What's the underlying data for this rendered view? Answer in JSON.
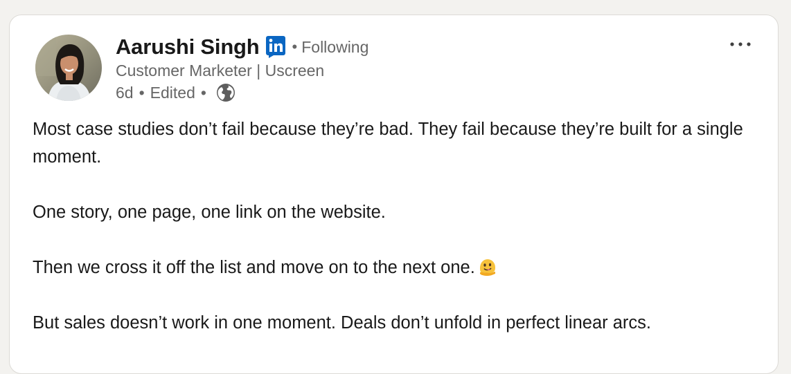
{
  "post": {
    "author": {
      "name": "Aarushi Singh",
      "follow_status": "Following",
      "separator": "•",
      "headline": "Customer Marketer | Uscreen"
    },
    "meta": {
      "age": "6d",
      "edited": "Edited",
      "separator": "•",
      "visibility_icon": "globe-icon"
    },
    "badge_icon": "linkedin-badge-icon",
    "more_icon": "more-options-icon",
    "body": {
      "paragraph_1": "Most case studies don’t fail because they’re bad. They fail because they’re built for a single moment.",
      "paragraph_2": "One story, one page, one link on the website.",
      "paragraph_3": "Then we cross it off the list and move on to the next one.",
      "paragraph_3_emoji": "melting-face-emoji",
      "paragraph_4": "But sales doesn’t work in one moment. Deals don’t unfold in perfect linear arcs."
    }
  },
  "colors": {
    "page_background": "#f3f2ef",
    "card_background": "#ffffff",
    "primary_text": "#191919",
    "secondary_text": "#666666",
    "linkedin_blue": "#0a66c2"
  }
}
